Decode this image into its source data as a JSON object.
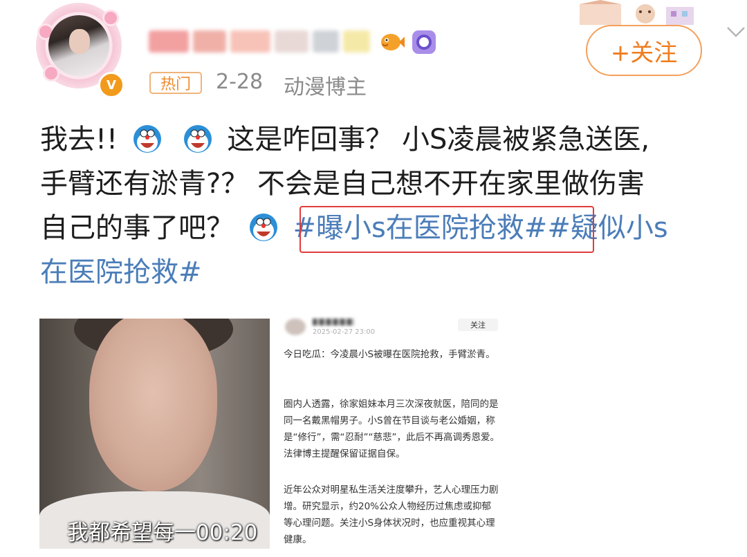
{
  "header": {
    "hot_label": "热门",
    "date": "2-28",
    "role": "动漫博主",
    "follow_label": "+关注",
    "verified_badge": "V"
  },
  "post": {
    "line1_a": "我去!!",
    "line1_b": "这是咋回事？ 小S凌晨被紧急送医,",
    "line2": "手臂还有淤青?？ 不会是自己想不开在家里做伤害",
    "line3_a": "自己的事了吧？",
    "tag1": "#曝小s在医院抢救#",
    "tag2_a": "#疑似小s",
    "tag2_b": "在医院抢救#"
  },
  "video": {
    "caption": "我都希望每一00:20"
  },
  "article": {
    "date": "2025-02-27 23:00",
    "follow_label": "关注",
    "p1": "今日吃瓜：今凌晨小S被曝在医院抢救，手臂淤青。",
    "p2": "圈内人透露，徐家姐妹本月三次深夜就医，陪同的是同一名戴黑帽男子。小S曾在节目谈与老公婚姻，称是“修行”，需“忍耐”“慈悲”，此后不再高调秀恩爱。法律博主提醒保留证据自保。",
    "p3": "近年公众对明星私生活关注度攀升，艺人心理压力剧增。研究显示，约20%公众人物经历过焦虑或抑郁等心理问题。关注小S身体状况时，也应重视其心理健康。"
  },
  "icons": {
    "emoji": "doraemon-emoji",
    "fish": "fish-badge-icon",
    "camera": "camera-badge-icon",
    "chevron": "chevron-down-icon"
  },
  "colors": {
    "accent_orange": "#f07c1e",
    "topic_blue": "#4b7db8",
    "highlight_red": "#e23a3a"
  }
}
